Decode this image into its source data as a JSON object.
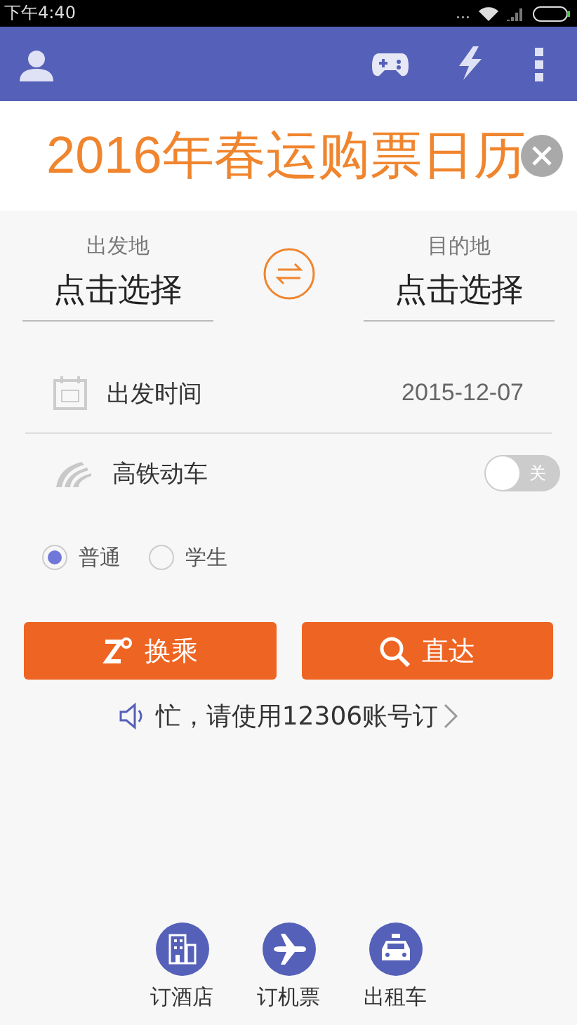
{
  "status_bar": {
    "time": "下午4:40",
    "dots": "..."
  },
  "banner": {
    "title": "2016年春运购票日历"
  },
  "from": {
    "label": "出发地",
    "value": "点击选择"
  },
  "to": {
    "label": "目的地",
    "value": "点击选择"
  },
  "date": {
    "label": "出发时间",
    "value": "2015-12-07"
  },
  "high_speed": {
    "label": "高铁动车",
    "on": false,
    "off_text": "关"
  },
  "ticket_types": [
    {
      "label": "普通",
      "selected": true
    },
    {
      "label": "学生",
      "selected": false
    }
  ],
  "buttons": [
    {
      "label": "换乘"
    },
    {
      "label": "直达"
    }
  ],
  "notice": {
    "text": "忙，请使用12306账号订"
  },
  "shortcuts": [
    {
      "label": "订酒店"
    },
    {
      "label": "订机票"
    },
    {
      "label": "出租车"
    }
  ]
}
